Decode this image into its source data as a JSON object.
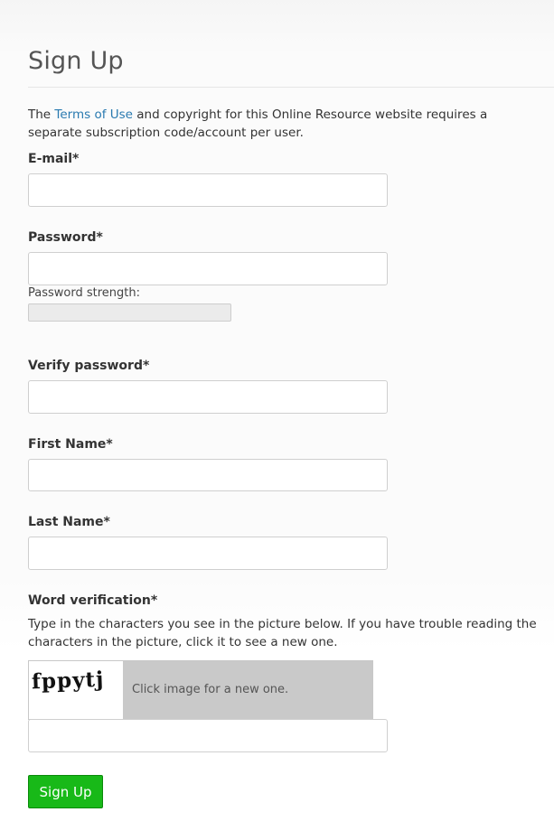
{
  "page": {
    "title": "Sign Up",
    "intro": {
      "prefix": "The ",
      "link_text": "Terms of Use",
      "suffix": " and copyright for this Online Resource website requires a separate subscription code/account per user."
    }
  },
  "form": {
    "email": {
      "label": "E-mail*",
      "value": "",
      "placeholder": ""
    },
    "password": {
      "label": "Password*",
      "value": "",
      "placeholder": ""
    },
    "password_strength": {
      "label": "Password strength:",
      "level": 0
    },
    "verify_password": {
      "label": "Verify password*",
      "value": "",
      "placeholder": ""
    },
    "first_name": {
      "label": "First Name*",
      "value": "",
      "placeholder": ""
    },
    "last_name": {
      "label": "Last Name*",
      "value": "",
      "placeholder": ""
    },
    "word_verification": {
      "label": "Word verification*",
      "help": "Type in the characters you see in the picture below. If you have trouble reading the characters in the picture, click it to see a new one.",
      "captcha_text": "fppytj",
      "captcha_hint": "Click image for a new one.",
      "value": "",
      "placeholder": ""
    },
    "submit_label": "Sign Up"
  },
  "colors": {
    "link": "#2a7ab0",
    "submit_button": "#18b918",
    "captcha_background": "#c9c9c9"
  },
  "icons": {}
}
